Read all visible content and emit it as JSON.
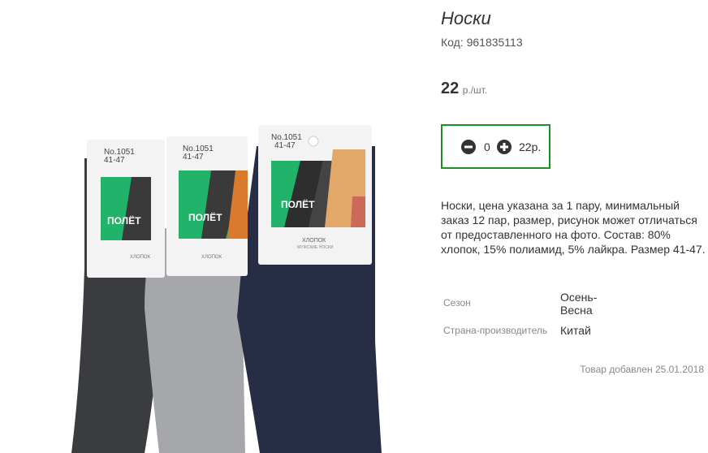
{
  "product": {
    "title": "Носки",
    "code": "Код: 961835113",
    "price": "22",
    "price_unit": "р./шт.",
    "description": "Носки, цена указана за 1 пару, минимальный заказ 12 пар, размер, рисунок может отличаться от предоставленного на фото. Состав: 80% хлопок, 15% полиамид, 5% лайкра. Размер 41-47.",
    "added": "Товар добавлен 25.01.2018"
  },
  "cart": {
    "quantity": "0",
    "total": "22р."
  },
  "properties": [
    {
      "label": "Сезон",
      "value": "Осень-Весна"
    },
    {
      "label": "Страна-производитель",
      "value": "Китай"
    }
  ],
  "image_labels": {
    "model": "No.1051",
    "size": "41-47",
    "brand": "ПОЛЁТ",
    "material": "ХЛОПОК",
    "type": "МУЖСКИЕ НОСКИ"
  },
  "colors": {
    "accent": "#1e8f24",
    "brand_green": "#22b36a"
  }
}
